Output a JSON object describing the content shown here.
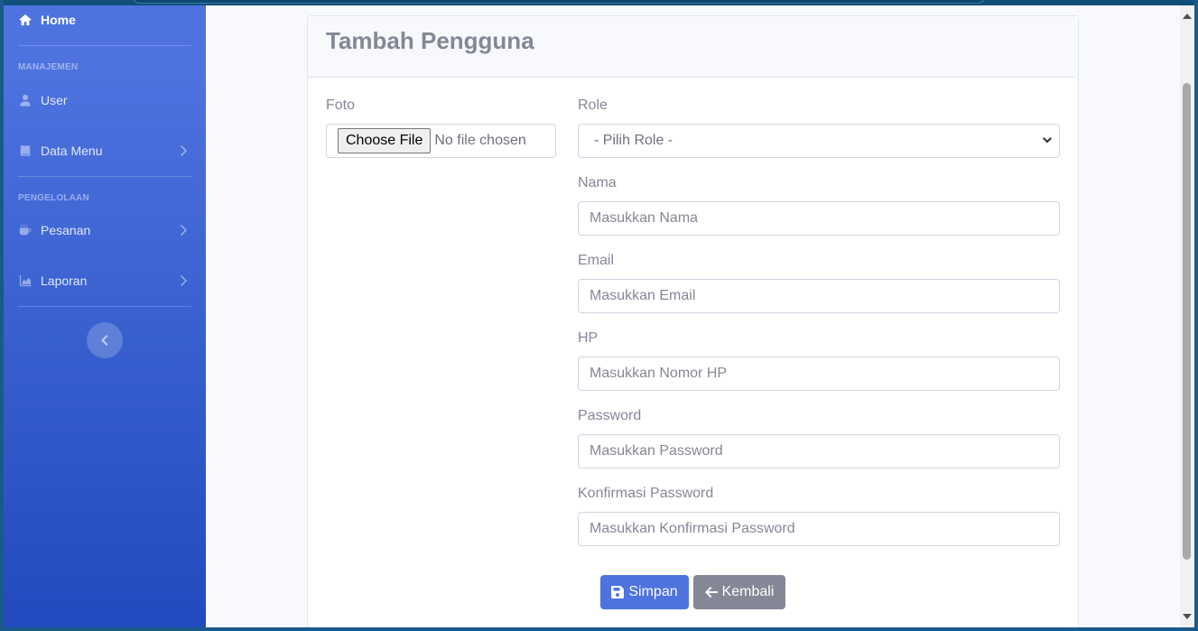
{
  "sidebar": {
    "home_label": "Home",
    "heading_manajemen": "MANAJEMEN",
    "user_label": "User",
    "data_menu_label": "Data Menu",
    "heading_pengelolaan": "PENGELOLAAN",
    "pesanan_label": "Pesanan",
    "laporan_label": "Laporan",
    "icons": [
      "home-icon",
      "user-icon",
      "book-icon",
      "coffee-icon",
      "chart-area-icon",
      "chevron-left-icon"
    ]
  },
  "card": {
    "title": "Tambah Pengguna"
  },
  "form": {
    "foto_label": "Foto",
    "file_button": "Choose File",
    "file_status": "No file chosen",
    "role_label": "Role",
    "role_selected": "- Pilih Role -",
    "nama_label": "Nama",
    "nama_placeholder": "Masukkan Nama",
    "email_label": "Email",
    "email_placeholder": "Masukkan Email",
    "hp_label": "HP",
    "hp_placeholder": "Masukkan Nomor HP",
    "password_label": "Password",
    "password_placeholder": "Masukkan Password",
    "konfirmasi_label": "Konfirmasi Password",
    "konfirmasi_placeholder": "Masukkan Konfirmasi Password"
  },
  "buttons": {
    "simpan": "Simpan",
    "kembali": "Kembali"
  },
  "colors": {
    "primary": "#4e73df",
    "secondary": "#858796",
    "sidebar_gradient_end": "#224abe"
  }
}
